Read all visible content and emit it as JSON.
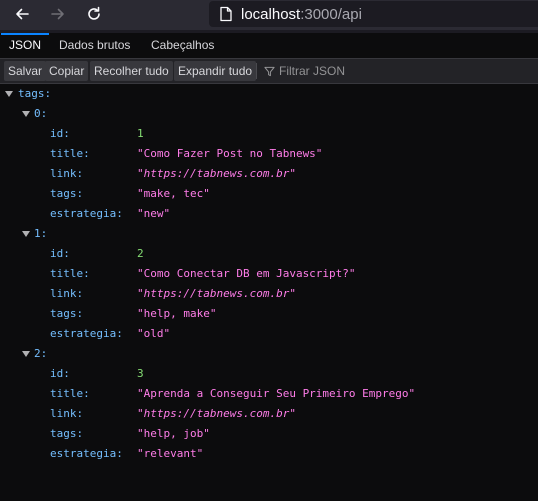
{
  "browser": {
    "url_host": "localhost",
    "url_path": ":3000/api"
  },
  "tabs": [
    {
      "label": "JSON",
      "active": true
    },
    {
      "label": "Dados brutos",
      "active": false
    },
    {
      "label": "Cabeçalhos",
      "active": false
    }
  ],
  "toolbar": {
    "save": "Salvar",
    "copy": "Copiar",
    "collapse_all": "Recolher tudo",
    "expand_all": "Expandir tudo",
    "filter_placeholder": "Filtrar JSON"
  },
  "tree": {
    "root_key": "tags:",
    "field_keys": {
      "id": "id:",
      "title": "title:",
      "link": "link:",
      "tags": "tags:",
      "estrategia": "estrategia:"
    },
    "items": [
      {
        "index": "0:",
        "id": "1",
        "title": "\"Como Fazer Post no Tabnews\"",
        "link": "\"https://tabnews.com.br\"",
        "tags": "\"make, tec\"",
        "estrategia": "\"new\""
      },
      {
        "index": "1:",
        "id": "2",
        "title": "\"Como Conectar DB em Javascript?\"",
        "link": "\"https://tabnews.com.br\"",
        "tags": "\"help, make\"",
        "estrategia": "\"old\""
      },
      {
        "index": "2:",
        "id": "3",
        "title": "\"Aprenda a Conseguir Seu Primeiro Emprego\"",
        "link": "\"https://tabnews.com.br\"",
        "tags": "\"help, job\"",
        "estrategia": "\"relevant\""
      }
    ]
  }
}
